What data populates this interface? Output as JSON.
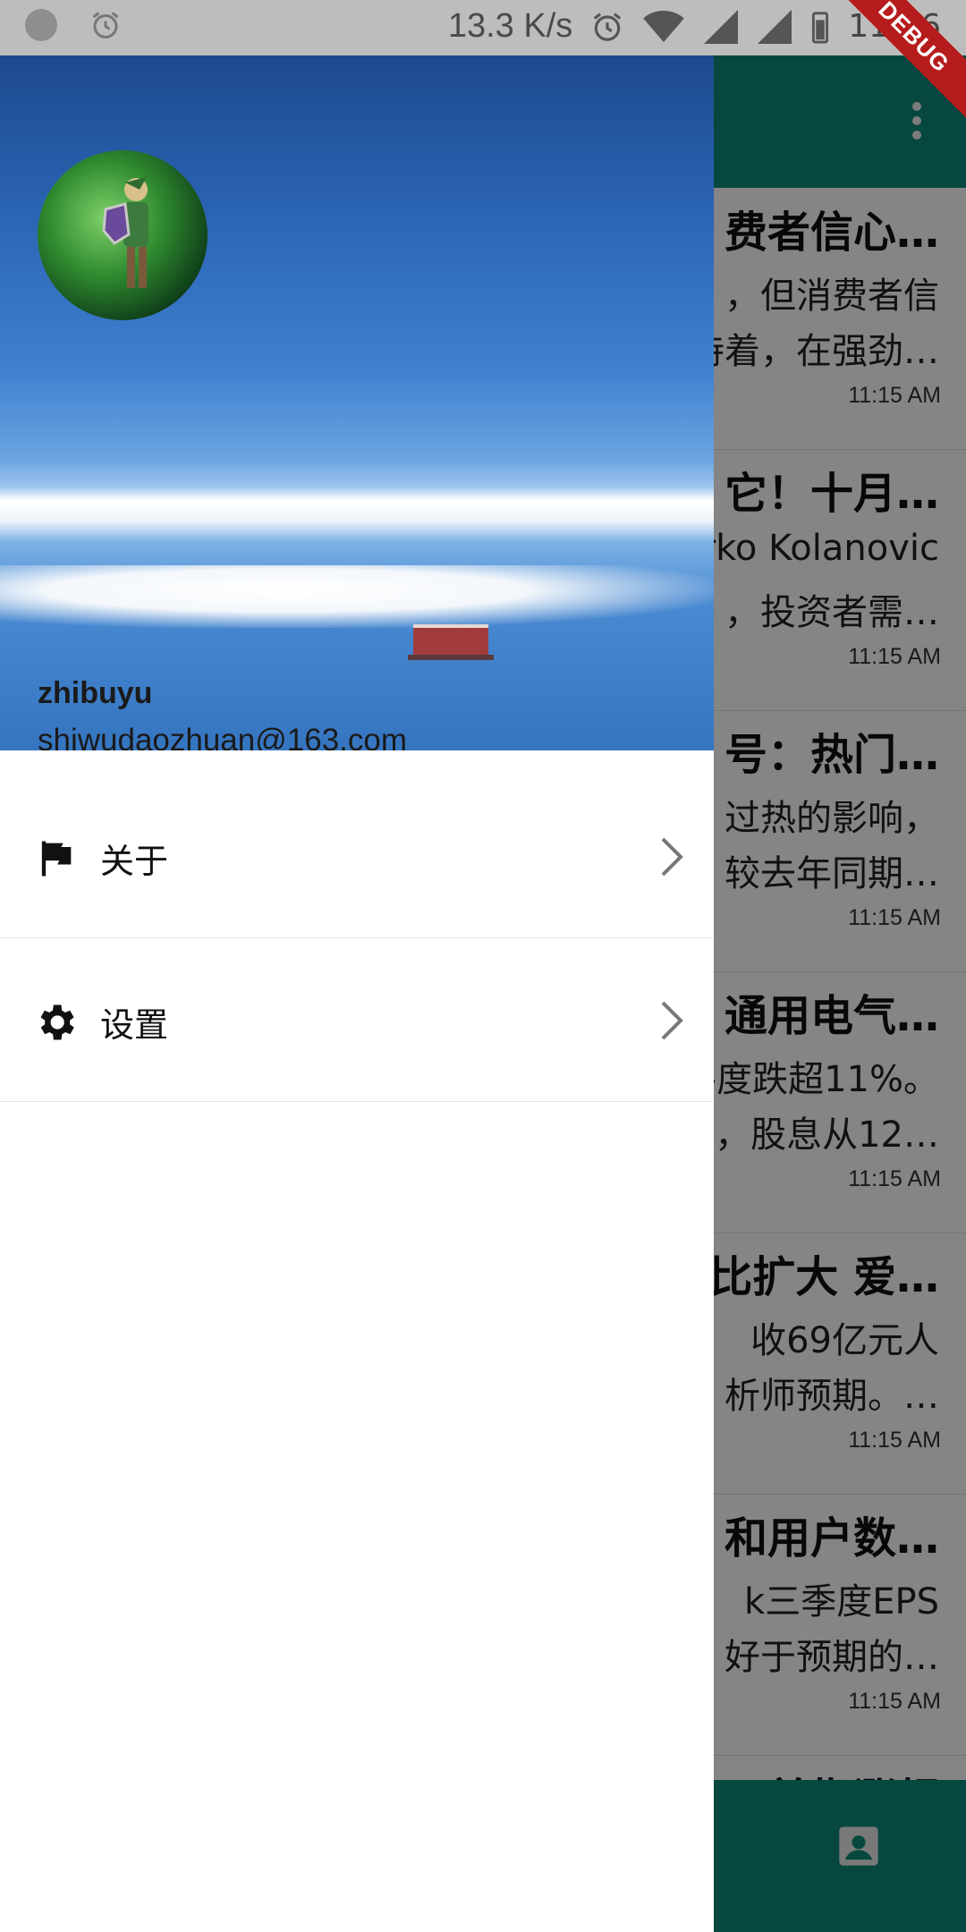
{
  "status_bar": {
    "network_speed": "13.3 K/s",
    "time": "11:26"
  },
  "debug_banner": "DEBUG",
  "drawer": {
    "account": {
      "name": "zhibuyu",
      "email": "shiwudaozhuan@163.com"
    },
    "menu": [
      {
        "label": "关于",
        "icon": "flag-icon"
      },
      {
        "label": "设置",
        "icon": "gear-icon"
      }
    ]
  },
  "feed": {
    "items": [
      {
        "title": "费者信心…",
        "line1": "，但消费者信",
        "line2": "持着，在强劲…",
        "time": "11:15 AM"
      },
      {
        "title": "它！十月…",
        "line1": "rko Kolanovic",
        "line2": "，投资者需…",
        "time": "11:15 AM"
      },
      {
        "title": "号：热门…",
        "line1": "过热的影响，",
        "line2": "较去年同期…",
        "time": "11:15 AM"
      },
      {
        "title": "通用电气…",
        "line1": "-度跌超11%。",
        "line2": "，股息从12…",
        "time": "11:15 AM"
      },
      {
        "title": "比扩大 爱…",
        "line1": "收69亿元人",
        "line2": "析师预期。…",
        "time": "11:15 AM"
      },
      {
        "title": "和用户数…",
        "line1": "k三季度EPS",
        "line2": "好于预期的…",
        "time": "11:15 AM"
      },
      {
        "title": "美指涨超",
        "line1": "",
        "line2": "",
        "time": ""
      }
    ]
  },
  "colors": {
    "app_bar": "#0d8a79",
    "debug": "#b71c1c"
  }
}
